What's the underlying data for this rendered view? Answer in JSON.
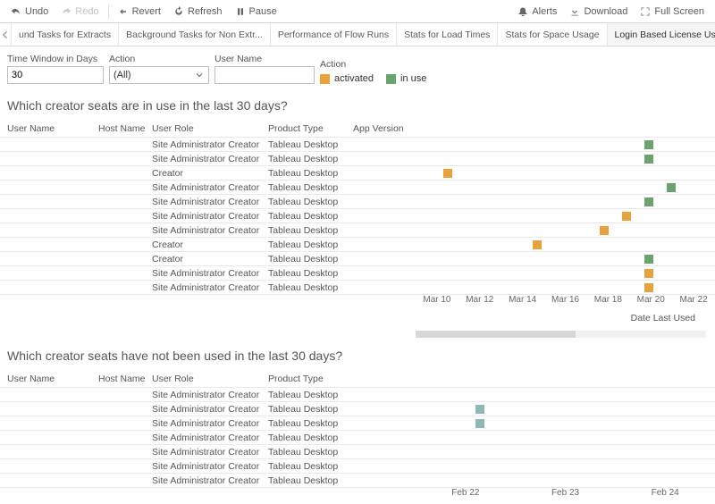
{
  "toolbar": {
    "undo": "Undo",
    "redo": "Redo",
    "revert": "Revert",
    "refresh": "Refresh",
    "pause": "Pause",
    "alerts": "Alerts",
    "download": "Download",
    "full_screen": "Full Screen"
  },
  "tabs": {
    "t0": "und Tasks for Extracts",
    "t1": "Background Tasks for Non Extr...",
    "t2": "Performance of Flow Runs",
    "t3": "Stats for Load Times",
    "t4": "Stats for Space Usage",
    "t5": "Login Based License Usage"
  },
  "filters": {
    "time_window_label": "Time Window in Days",
    "time_window_value": "30",
    "action_label": "Action",
    "action_value": "(All)",
    "user_name_label": "User Name",
    "user_name_value": "",
    "legend_title": "Action",
    "legend_activated": "activated",
    "legend_in_use": "in use"
  },
  "colors": {
    "activated": "#e8a23d",
    "in_use": "#6aa36f",
    "unused_mark": "#8fb8b3"
  },
  "section1": {
    "title": "Which creator seats are in use in the last 30 days?",
    "hdr_user": "User Name",
    "hdr_host": "Host Name",
    "hdr_role": "User Role",
    "hdr_product": "Product Type",
    "hdr_app": "App Version",
    "axis_label": "Date Last Used"
  },
  "section2": {
    "title": "Which creator seats have not been used in the last 30 days?",
    "hdr_user": "User Name",
    "hdr_host": "Host Name",
    "hdr_role": "User Role",
    "hdr_product": "Product Type"
  },
  "chart_data": {
    "chart1": {
      "type": "scatter",
      "xlabel": "Date Last Used",
      "x_ticks": [
        "Mar 10",
        "Mar 12",
        "Mar 14",
        "Mar 16",
        "Mar 18",
        "Mar 20",
        "Mar 22"
      ],
      "rows": [
        {
          "role": "Site Administrator Creator",
          "product": "Tableau Desktop",
          "action": "in_use",
          "date": "Mar 20"
        },
        {
          "role": "Site Administrator Creator",
          "product": "Tableau Desktop",
          "action": "in_use",
          "date": "Mar 20"
        },
        {
          "role": "Creator",
          "product": "Tableau Desktop",
          "action": "activated",
          "date": "Mar 11"
        },
        {
          "role": "Site Administrator Creator",
          "product": "Tableau Desktop",
          "action": "in_use",
          "date": "Mar 21"
        },
        {
          "role": "Site Administrator Creator",
          "product": "Tableau Desktop",
          "action": "in_use",
          "date": "Mar 20"
        },
        {
          "role": "Site Administrator Creator",
          "product": "Tableau Desktop",
          "action": "activated",
          "date": "Mar 19"
        },
        {
          "role": "Site Administrator Creator",
          "product": "Tableau Desktop",
          "action": "activated",
          "date": "Mar 18"
        },
        {
          "role": "Creator",
          "product": "Tableau Desktop",
          "action": "activated",
          "date": "Mar 15"
        },
        {
          "role": "Creator",
          "product": "Tableau Desktop",
          "action": "in_use",
          "date": "Mar 20"
        },
        {
          "role": "Site Administrator Creator",
          "product": "Tableau Desktop",
          "action": "activated",
          "date": "Mar 20"
        },
        {
          "role": "Site Administrator Creator",
          "product": "Tableau Desktop",
          "action": "activated",
          "date": "Mar 20"
        }
      ]
    },
    "chart2": {
      "type": "scatter",
      "x_ticks": [
        "Feb 22",
        "Feb 23",
        "Feb 24"
      ],
      "rows": [
        {
          "role": "Site Administrator Creator",
          "product": "Tableau Desktop",
          "date": null
        },
        {
          "role": "Site Administrator Creator",
          "product": "Tableau Desktop",
          "date": "Feb 22.3"
        },
        {
          "role": "Site Administrator Creator",
          "product": "Tableau Desktop",
          "date": "Feb 22.3"
        },
        {
          "role": "Site Administrator Creator",
          "product": "Tableau Desktop",
          "date": null
        },
        {
          "role": "Site Administrator Creator",
          "product": "Tableau Desktop",
          "date": null
        },
        {
          "role": "Site Administrator Creator",
          "product": "Tableau Desktop",
          "date": null
        },
        {
          "role": "Site Administrator Creator",
          "product": "Tableau Desktop",
          "date": null
        }
      ]
    }
  }
}
